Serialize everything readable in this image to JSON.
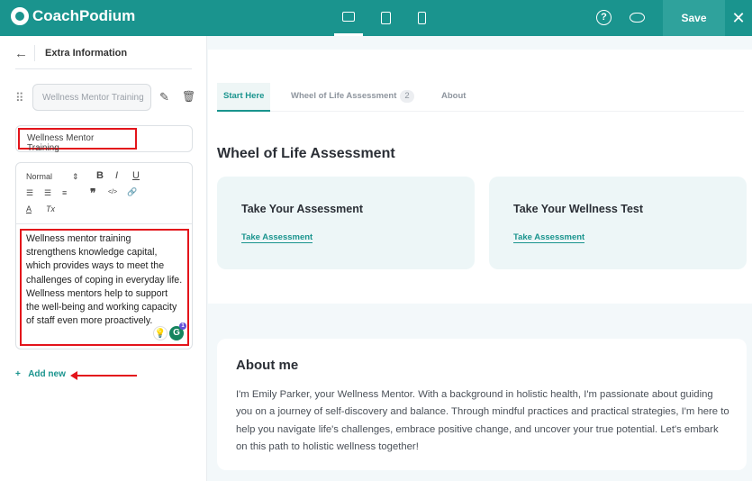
{
  "header": {
    "brand": "CoachPodium",
    "save_label": "Save",
    "close_symbol": "✕",
    "help_symbol": "?",
    "devices": [
      "desktop",
      "tablet",
      "mobile"
    ],
    "active_device": "desktop",
    "accent": "#1a948e"
  },
  "panel": {
    "title": "Extra Information",
    "item_chip": "Wellness Mentor Training",
    "title_input": "Wellness Mentor Training",
    "toolbar": {
      "format": "Normal",
      "bold": "B",
      "italic": "I",
      "underline": "U",
      "quote": "❞",
      "code": "</>",
      "color": "A",
      "clear": "Tx"
    },
    "body_text": "Wellness mentor training strengthens knowledge capital, which provides ways to meet the challenges of coping in everyday life. Wellness mentors help to support the well-being and working capacity of staff even more proactively.",
    "grammarly_badge": "1",
    "grammarly_letter": "G",
    "add_new": "Add new",
    "add_symbol": "+"
  },
  "preview": {
    "tabs": [
      {
        "label": "Start Here",
        "active": true
      },
      {
        "label": "Wheel of Life Assessment",
        "badge": "2"
      },
      {
        "label": "About"
      }
    ],
    "section_title": "Wheel of Life Assessment",
    "cards": [
      {
        "title": "Take Your Assessment",
        "link": "Take Assessment"
      },
      {
        "title": "Take Your Wellness Test",
        "link": "Take Assessment"
      }
    ],
    "about": {
      "title": "About me",
      "text": "I'm Emily Parker, your Wellness Mentor. With a background in holistic health, I'm passionate about guiding you on a journey of self-discovery and balance. Through mindful practices and practical strategies, I'm here to help you navigate life's challenges, embrace positive change, and uncover your true potential. Let's embark on this path to holistic wellness together!"
    }
  }
}
